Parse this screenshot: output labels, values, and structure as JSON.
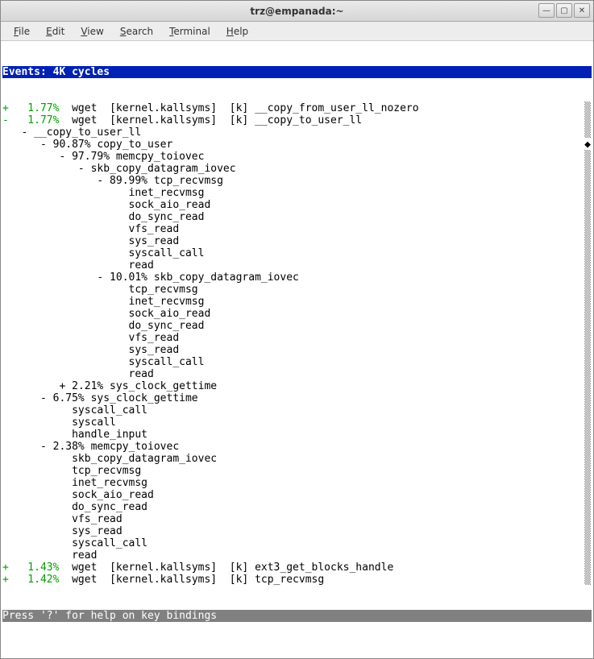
{
  "window": {
    "title": "trz@empanada:~"
  },
  "menu": {
    "file": "File",
    "edit": "Edit",
    "view": "View",
    "search": "Search",
    "terminal": "Terminal",
    "help": "Help"
  },
  "header": "Events: 4K cycles                                                          ",
  "lines": [
    {
      "sign": "+",
      "percent": "   1.77%",
      "rest": "  wget  [kernel.kallsyms]  [k] __copy_from_user_ll_nozero",
      "scroll": "▒"
    },
    {
      "sign": "-",
      "percent": "   1.77%",
      "rest": "  wget  [kernel.kallsyms]  [k] __copy_to_user_ll",
      "scroll": "▒"
    },
    {
      "plain": "   - __copy_to_user_ll",
      "scroll": "▒"
    },
    {
      "plain": "      - 90.87% copy_to_user",
      "scroll": "◆"
    },
    {
      "plain": "         - 97.79% memcpy_toiovec",
      "scroll": "▒"
    },
    {
      "plain": "            - skb_copy_datagram_iovec",
      "scroll": "▒"
    },
    {
      "plain": "               - 89.99% tcp_recvmsg",
      "scroll": "▒"
    },
    {
      "plain": "                    inet_recvmsg",
      "scroll": "▒"
    },
    {
      "plain": "                    sock_aio_read",
      "scroll": "▒"
    },
    {
      "plain": "                    do_sync_read",
      "scroll": "▒"
    },
    {
      "plain": "                    vfs_read",
      "scroll": "▒"
    },
    {
      "plain": "                    sys_read",
      "scroll": "▒"
    },
    {
      "plain": "                    syscall_call",
      "scroll": "▒"
    },
    {
      "plain": "                    read",
      "scroll": "▒"
    },
    {
      "plain": "               - 10.01% skb_copy_datagram_iovec",
      "scroll": "▒"
    },
    {
      "plain": "                    tcp_recvmsg",
      "scroll": "▒"
    },
    {
      "plain": "                    inet_recvmsg",
      "scroll": "▒"
    },
    {
      "plain": "                    sock_aio_read",
      "scroll": "▒"
    },
    {
      "plain": "                    do_sync_read",
      "scroll": "▒"
    },
    {
      "plain": "                    vfs_read",
      "scroll": "▒"
    },
    {
      "plain": "                    sys_read",
      "scroll": "▒"
    },
    {
      "plain": "                    syscall_call",
      "scroll": "▒"
    },
    {
      "plain": "                    read",
      "scroll": "▒"
    },
    {
      "plain": "         + 2.21% sys_clock_gettime",
      "scroll": "▒"
    },
    {
      "plain": "      - 6.75% sys_clock_gettime",
      "scroll": "▒"
    },
    {
      "plain": "           syscall_call",
      "scroll": "▒"
    },
    {
      "plain": "           syscall",
      "scroll": "▒"
    },
    {
      "plain": "           handle_input",
      "scroll": "▒"
    },
    {
      "plain": "      - 2.38% memcpy_toiovec",
      "scroll": "▒"
    },
    {
      "plain": "           skb_copy_datagram_iovec",
      "scroll": "▒"
    },
    {
      "plain": "           tcp_recvmsg",
      "scroll": "▒"
    },
    {
      "plain": "           inet_recvmsg",
      "scroll": "▒"
    },
    {
      "plain": "           sock_aio_read",
      "scroll": "▒"
    },
    {
      "plain": "           do_sync_read",
      "scroll": "▒"
    },
    {
      "plain": "           vfs_read",
      "scroll": "▒"
    },
    {
      "plain": "           sys_read",
      "scroll": "▒"
    },
    {
      "plain": "           syscall_call",
      "scroll": "▒"
    },
    {
      "plain": "           read",
      "scroll": "▒"
    },
    {
      "sign": "+",
      "percent": "   1.43%",
      "rest": "  wget  [kernel.kallsyms]  [k] ext3_get_blocks_handle",
      "scroll": "▒"
    },
    {
      "sign": "+",
      "percent": "   1.42%",
      "rest": "  wget  [kernel.kallsyms]  [k] tcp_recvmsg",
      "scroll": "▒"
    }
  ],
  "footer": "Press '?' for help on key bindings                                         "
}
